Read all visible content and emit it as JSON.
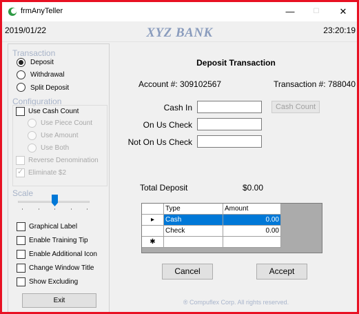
{
  "window": {
    "title": "frmAnyTeller",
    "minimize_glyph": "—",
    "maximize_glyph": "☐",
    "close_glyph": "✕"
  },
  "header": {
    "date": "2019/01/22",
    "bank_name": "XYZ BANK",
    "time": "23:20:19"
  },
  "sidebar": {
    "transaction_title": "Transaction",
    "transaction_options": [
      {
        "label": "Deposit",
        "selected": true
      },
      {
        "label": "Withdrawal",
        "selected": false
      },
      {
        "label": "Split Deposit",
        "selected": false
      }
    ],
    "configuration_title": "Configuration",
    "use_cash_count": "Use Cash Count",
    "piece_options": [
      "Use Piece Count",
      "Use Amount",
      "Use Both"
    ],
    "reverse_denomination": "Reverse Denomination",
    "eliminate_2": "Eliminate $2",
    "scale_title": "Scale",
    "scale_level": 0.56,
    "options": [
      "Graphical Label",
      "Enable Training Tip",
      "Enable Additional Icon",
      "Change Window Title",
      "Show Excluding"
    ],
    "exit_label": "Exit"
  },
  "main": {
    "title": "Deposit Transaction",
    "account_label": "Account #: 309102567",
    "transaction_label": "Transaction #:  788040",
    "cash_in_label": "Cash In",
    "on_us_check_label": "On Us Check",
    "not_on_us_check_label": "Not On Us Check",
    "cash_count_label": "Cash Count",
    "total_deposit_label": "Total Deposit",
    "total_deposit_value": "$0.00",
    "grid": {
      "headers": [
        "Type",
        "Amount"
      ],
      "rows": [
        {
          "type": "Cash",
          "amount": "0.00",
          "row_marker": "▸"
        },
        {
          "type": "Check",
          "amount": "0.00",
          "row_marker": ""
        }
      ],
      "new_row_marker": "✱"
    },
    "cancel_label": "Cancel",
    "accept_label": "Accept",
    "copyright": "® Compuflex Corp. All rights reserved."
  },
  "colors": {
    "frame_border": "#e81123",
    "accent_selection": "#0078d7",
    "section_title": "#a7b3c8",
    "bank_name": "#8a9cbd"
  }
}
